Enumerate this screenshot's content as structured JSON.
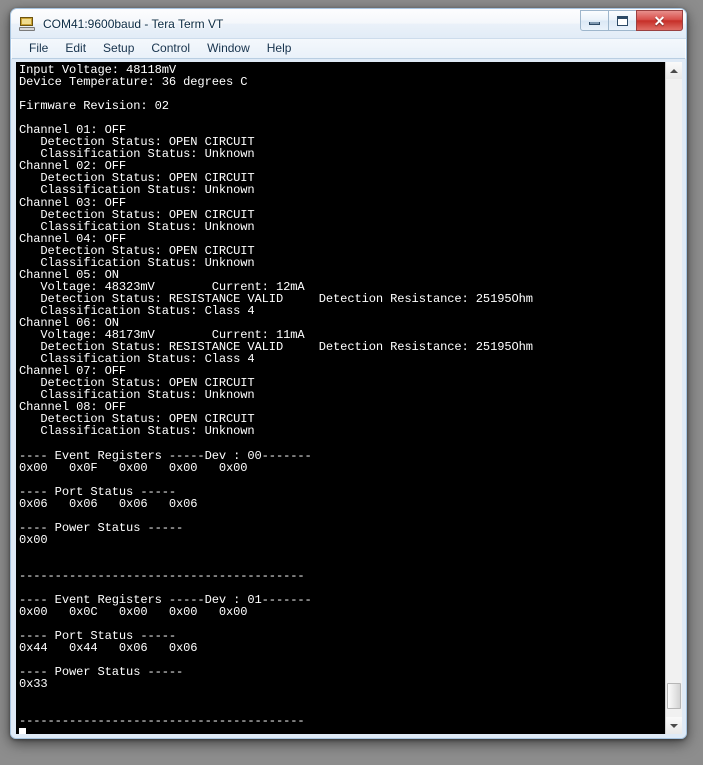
{
  "window": {
    "title": "COM41:9600baud - Tera Term VT",
    "icon": "terminal-icon",
    "controls": {
      "minimize": "Minimize",
      "maximize": "Maximize",
      "close": "✕"
    }
  },
  "menubar": {
    "items": [
      {
        "label": "File"
      },
      {
        "label": "Edit"
      },
      {
        "label": "Setup"
      },
      {
        "label": "Control"
      },
      {
        "label": "Window"
      },
      {
        "label": "Help"
      }
    ]
  },
  "terminal": {
    "colors": {
      "background": "#000000",
      "foreground": "#ffffff"
    },
    "header": {
      "input_voltage": "Input Voltage: 48118mV",
      "device_temperature": "Device Temperature: 36 degrees C",
      "firmware_revision": "Firmware Revision: 02"
    },
    "channels": [
      {
        "title": "Channel 01: OFF",
        "detection_status": "   Detection Status: OPEN CIRCUIT",
        "classification_status": "   Classification Status: Unknown"
      },
      {
        "title": "Channel 02: OFF",
        "detection_status": "   Detection Status: OPEN CIRCUIT",
        "classification_status": "   Classification Status: Unknown"
      },
      {
        "title": "Channel 03: OFF",
        "detection_status": "   Detection Status: OPEN CIRCUIT",
        "classification_status": "   Classification Status: Unknown"
      },
      {
        "title": "Channel 04: OFF",
        "detection_status": "   Detection Status: OPEN CIRCUIT",
        "classification_status": "   Classification Status: Unknown"
      },
      {
        "title": "Channel 05: ON",
        "measurements": "   Voltage: 48323mV        Current: 12mA",
        "detection_status": "   Detection Status: RESISTANCE VALID     Detection Resistance: 25195Ohm",
        "classification_status": "   Classification Status: Class 4"
      },
      {
        "title": "Channel 06: ON",
        "measurements": "   Voltage: 48173mV        Current: 11mA",
        "detection_status": "   Detection Status: RESISTANCE VALID     Detection Resistance: 25195Ohm",
        "classification_status": "   Classification Status: Class 4"
      },
      {
        "title": "Channel 07: OFF",
        "detection_status": "   Detection Status: OPEN CIRCUIT",
        "classification_status": "   Classification Status: Unknown"
      },
      {
        "title": "Channel 08: OFF",
        "detection_status": "   Detection Status: OPEN CIRCUIT",
        "classification_status": "   Classification Status: Unknown"
      }
    ],
    "devices": [
      {
        "event_registers_header": "---- Event Registers -----Dev : 00-------",
        "event_registers_values": "0x00   0x0F   0x00   0x00   0x00",
        "port_status_header": "---- Port Status -----",
        "port_status_values": "0x06   0x06   0x06   0x06",
        "power_status_header": "---- Power Status -----",
        "power_status_values": "0x00",
        "separator": "----------------------------------------"
      },
      {
        "event_registers_header": "---- Event Registers -----Dev : 01-------",
        "event_registers_values": "0x00   0x0C   0x00   0x00   0x00",
        "port_status_header": "---- Port Status -----",
        "port_status_values": "0x44   0x44   0x06   0x06",
        "power_status_header": "---- Power Status -----",
        "power_status_values": "0x33",
        "separator": "----------------------------------------"
      }
    ],
    "full_text": "Input Voltage: 48118mV\nDevice Temperature: 36 degrees C\n\nFirmware Revision: 02\n\nChannel 01: OFF\n   Detection Status: OPEN CIRCUIT\n   Classification Status: Unknown\nChannel 02: OFF\n   Detection Status: OPEN CIRCUIT\n   Classification Status: Unknown\nChannel 03: OFF\n   Detection Status: OPEN CIRCUIT\n   Classification Status: Unknown\nChannel 04: OFF\n   Detection Status: OPEN CIRCUIT\n   Classification Status: Unknown\nChannel 05: ON\n   Voltage: 48323mV        Current: 12mA\n   Detection Status: RESISTANCE VALID     Detection Resistance: 25195Ohm\n   Classification Status: Class 4\nChannel 06: ON\n   Voltage: 48173mV        Current: 11mA\n   Detection Status: RESISTANCE VALID     Detection Resistance: 25195Ohm\n   Classification Status: Class 4\nChannel 07: OFF\n   Detection Status: OPEN CIRCUIT\n   Classification Status: Unknown\nChannel 08: OFF\n   Detection Status: OPEN CIRCUIT\n   Classification Status: Unknown\n\n---- Event Registers -----Dev : 00-------\n0x00   0x0F   0x00   0x00   0x00\n\n---- Port Status -----\n0x06   0x06   0x06   0x06\n\n---- Power Status -----\n0x00\n\n\n----------------------------------------\n\n---- Event Registers -----Dev : 01-------\n0x00   0x0C   0x00   0x00   0x00\n\n---- Port Status -----\n0x44   0x44   0x06   0x06\n\n---- Power Status -----\n0x33\n\n\n----------------------------------------\n"
  },
  "scrollbar": {
    "up_arrow": "scroll-up",
    "down_arrow": "scroll-down",
    "thumb": "scroll-thumb"
  }
}
